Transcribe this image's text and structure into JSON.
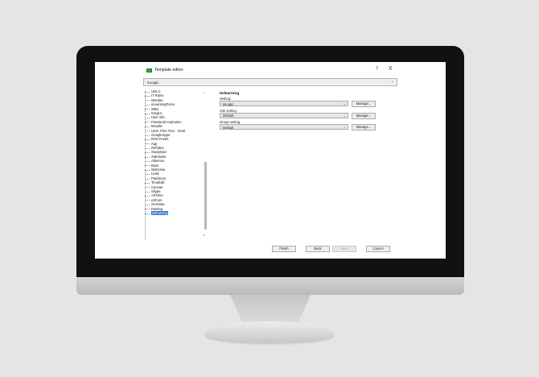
{
  "dialog": {
    "title": "Template editor",
    "help_label": "?",
    "close_label": "X",
    "template_value": "inLogic",
    "chevron": "⌄"
  },
  "tree": {
    "items": [
      "UNI-C",
      "IT Rules",
      "Wordier",
      "eLearningForce",
      "SMS",
      "Integro",
      "User info",
      "Password expiration",
      "Moodle",
      "Umb. Pine Tree - DAM",
      "GoogleApps",
      "RSS Feeds",
      "App",
      "Refrides",
      "StudyQuiz",
      "Safeticket",
      "Absence",
      "Boss",
      "Welcome",
      "Links",
      "ParkZone",
      "TimeEdit",
      "Canvas",
      "Skype",
      "APODA",
      "edCom",
      "OneNote",
      "Parking",
      "itslearning"
    ],
    "selected_index": 28
  },
  "panel": {
    "section_title": "itslearning",
    "fields": [
      {
        "label": "Setting:",
        "value": "inLogic",
        "button": "Manage..."
      },
      {
        "label": "Site setting:",
        "value": "Default",
        "button": "Manage..."
      },
      {
        "label": "Group setting:",
        "value": "Default",
        "button": "Manage..."
      }
    ]
  },
  "footer": {
    "finish": "Finish",
    "back": "Back",
    "next": "Next",
    "cancel": "Cancel"
  },
  "colors": {
    "selection": "#2f76d2",
    "app_icon": "#3ca73f"
  }
}
